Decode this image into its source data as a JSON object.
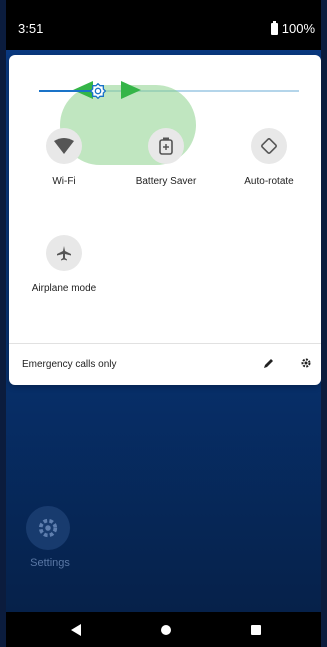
{
  "status_bar": {
    "time": "3:51",
    "battery": "100%"
  },
  "quick_settings": {
    "tiles": [
      {
        "label": "Wi-Fi",
        "icon": "wifi-icon"
      },
      {
        "label": "Battery Saver",
        "icon": "battery-saver-icon"
      },
      {
        "label": "Auto-rotate",
        "icon": "auto-rotate-icon"
      },
      {
        "label": "Airplane mode",
        "icon": "airplane-icon"
      }
    ],
    "brightness_level": 0.22,
    "footer_text": "Emergency calls only"
  },
  "home": {
    "app_label": "Settings"
  },
  "colors": {
    "accent": "#1a73c8",
    "gesture_hint": "#35b548"
  }
}
